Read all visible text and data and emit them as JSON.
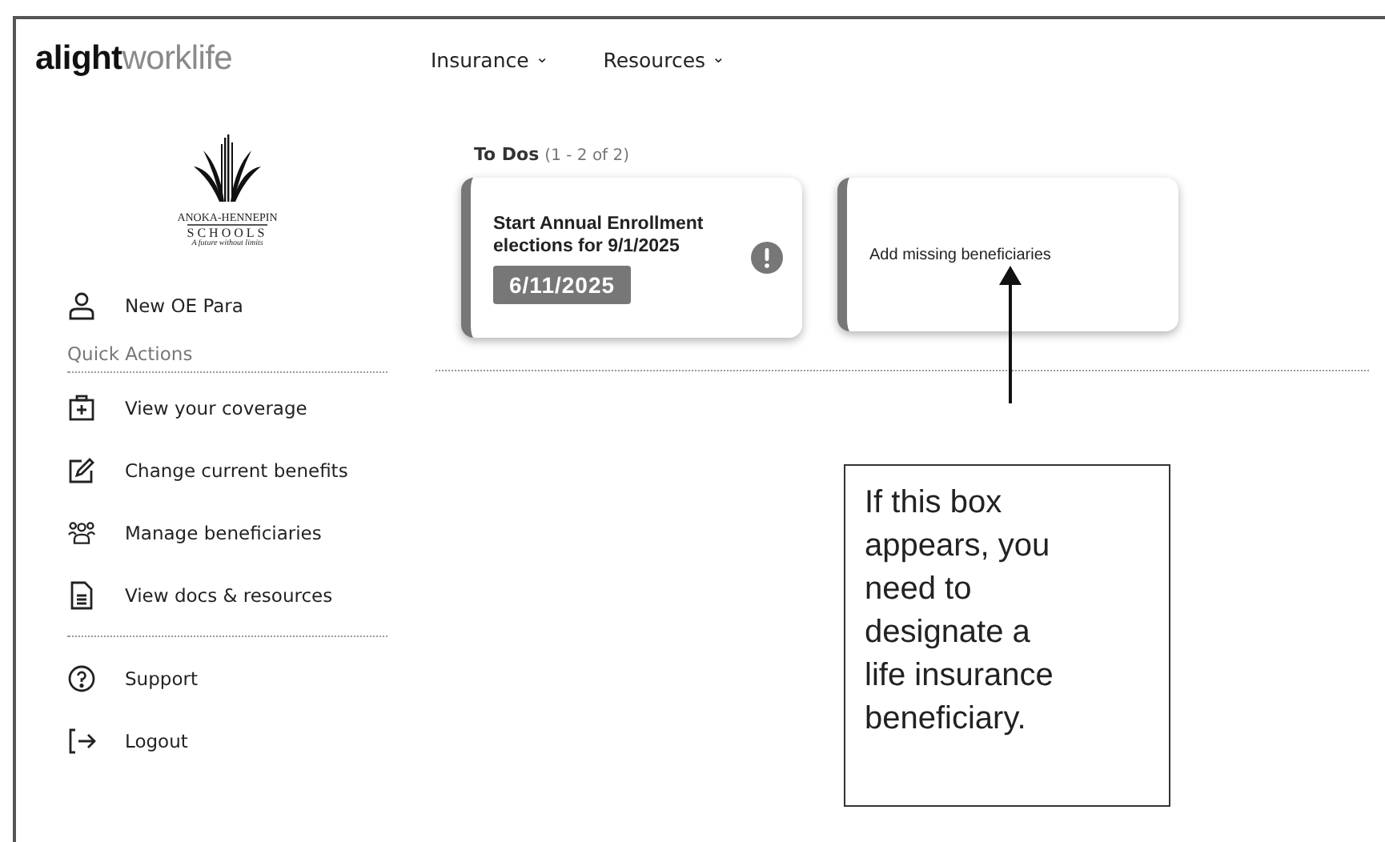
{
  "logo": {
    "bold": "alight",
    "light": "worklife"
  },
  "nav": [
    {
      "label": "Insurance",
      "caret": "⌄"
    },
    {
      "label": "Resources",
      "caret": "⌄"
    }
  ],
  "school": {
    "name": "ANOKA-HENNEPIN",
    "sub": "SCHOOLS",
    "motto": "A future without limits"
  },
  "user": {
    "name": "New OE Para"
  },
  "quick_actions": {
    "title": "Quick Actions",
    "items": [
      {
        "kind": "coverage",
        "label": "View your coverage"
      },
      {
        "kind": "edit",
        "label": "Change current benefits"
      },
      {
        "kind": "people",
        "label": "Manage beneficiaries"
      },
      {
        "kind": "doc",
        "label": "View docs & resources"
      }
    ]
  },
  "footer_items": [
    {
      "kind": "help",
      "label": "Support"
    },
    {
      "kind": "logout",
      "label": "Logout"
    }
  ],
  "todos": {
    "title": "To Dos",
    "count": "(1 - 2 of 2)",
    "cards": [
      {
        "kind": "enrollment",
        "title": "Start Annual Enrollment elections for 9/1/2025",
        "date": "6/11/2025"
      },
      {
        "kind": "plain",
        "title": "Add missing beneficiaries"
      }
    ]
  },
  "annotation": {
    "text": "If this box appears, you need to designate a life insurance beneficiary."
  }
}
